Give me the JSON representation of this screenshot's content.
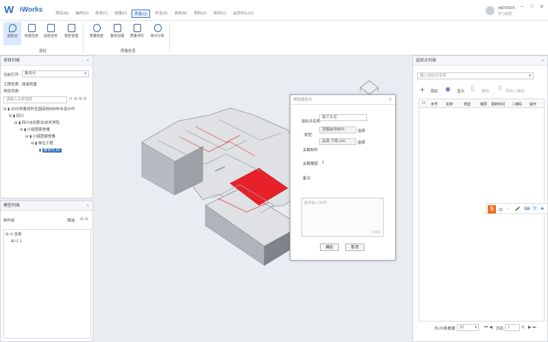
{
  "app": {
    "name": "iWorks"
  },
  "menu": [
    "项目(M)",
    "操作(O)",
    "技术(T)",
    "进度(F)",
    "质量(Q)",
    "安全(S)",
    "商务(B)",
    "资料(D)",
    "协同(C)",
    "会员中心(U)"
  ],
  "user": {
    "name": "wlj200025",
    "role": "学习权限"
  },
  "ribbon": {
    "buttons": [
      "巡检点",
      "新建任务",
      "巡检任务",
      "报告管理",
      "质量检查",
      "整改治理",
      "质量评优",
      "统计分析"
    ],
    "group1": "巡检",
    "group2": "质量检查"
  },
  "project": {
    "title": "项目列表",
    "current_label": "当前打开:",
    "current_value": "教育代",
    "engineer_label": "工程性质:",
    "engineer_value": "简单房屋",
    "list_label": "项目列表:",
    "search_placeholder": "请输入名称搜索",
    "tree": [
      "2022年鲁班杯全国高校BIM毕业设计作",
      "四川",
      "四川水利职业技术学院",
      "小组团宿舍楼",
      "小组团宿舍楼",
      "单位工程",
      "教育代.50"
    ]
  },
  "model": {
    "title": "模型列表",
    "tree_label": "构件树",
    "filter_label": "筛选",
    "items": [
      "全部",
      "1"
    ]
  },
  "dialog": {
    "title": "添加巡检点",
    "name_label": "巡检点名称:",
    "name_value": "客厅天花",
    "type_label": "类型:",
    "type_value1": "顶棚装饰构件:",
    "type_value2": "高度:下限:200",
    "select_btn": "选择",
    "component_label": "关联构件:",
    "status_label": "关联楼层:",
    "status_value": "1",
    "note_label": "备注:",
    "note_placeholder": "最多输入150字",
    "counter": "0/150",
    "ok": "确定",
    "cancel": "取消"
  },
  "right": {
    "title": "巡检点列表",
    "search_placeholder": "输入巡检点名称",
    "add": "添加",
    "show": "显示",
    "delete": "删除",
    "export": "导出二维码",
    "columns": [
      "序号",
      "名称",
      "类型",
      "楼层",
      "更新时间",
      "二维码",
      "操作"
    ],
    "total": "共计0条数据",
    "page_size": "20",
    "page_label": "页码",
    "page_value": "1",
    "page_total": "/1"
  },
  "ime": {
    "labels": [
      "中",
      "·,",
      "🎤",
      "⌨",
      "👕",
      "❖"
    ]
  }
}
